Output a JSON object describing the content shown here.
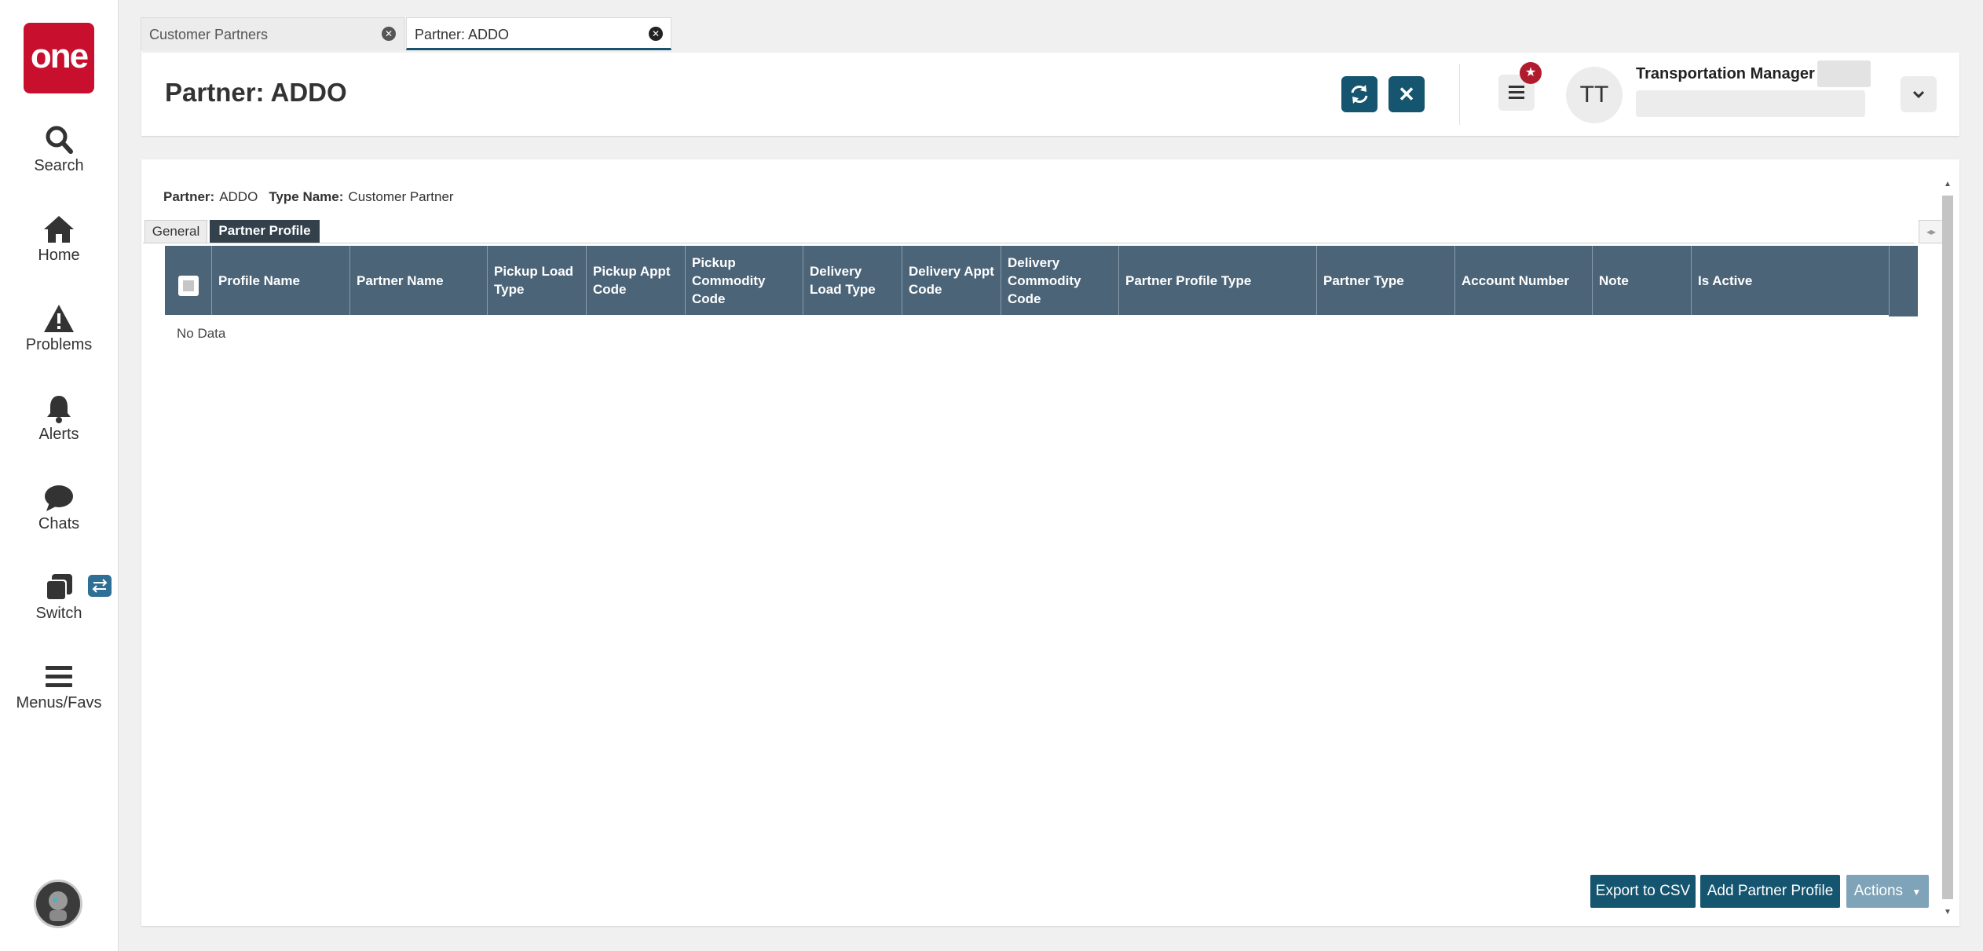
{
  "nav": {
    "logo_text": "one",
    "items": [
      {
        "label": "Search",
        "icon": "search-icon"
      },
      {
        "label": "Home",
        "icon": "home-icon"
      },
      {
        "label": "Problems",
        "icon": "warning-icon"
      },
      {
        "label": "Alerts",
        "icon": "bell-icon"
      },
      {
        "label": "Chats",
        "icon": "chat-bubble-icon"
      },
      {
        "label": "Switch",
        "icon": "switch-icon"
      },
      {
        "label": "Menus/Favs",
        "icon": "hamburger-menu-icon"
      }
    ]
  },
  "tabs": [
    {
      "label": "Customer Partners",
      "active": false
    },
    {
      "label": "Partner: ADDO",
      "active": true
    }
  ],
  "header": {
    "title": "Partner: ADDO",
    "user_initials": "TT",
    "user_role": "Transportation Manager"
  },
  "summary": {
    "partner_label": "Partner:",
    "partner_value": "ADDO",
    "type_label": "Type Name:",
    "type_value": "Customer Partner"
  },
  "subtabs": [
    {
      "label": "General",
      "active": false
    },
    {
      "label": "Partner Profile",
      "active": true
    }
  ],
  "grid": {
    "columns": [
      "Profile Name",
      "Partner Name",
      "Pickup Load Type",
      "Pickup Appt Code",
      "Pickup Commodity Code",
      "Delivery Load Type",
      "Delivery Appt Code",
      "Delivery Commodity Code",
      "Partner Profile Type",
      "Partner Type",
      "Account Number",
      "Note",
      "Is Active"
    ],
    "empty_text": "No Data"
  },
  "footer": {
    "export_label": "Export to CSV",
    "add_label": "Add Partner Profile",
    "actions_label": "Actions"
  },
  "colors": {
    "brand_red": "#c8102e",
    "primary_button": "#15556f",
    "grid_header": "#4b6478",
    "active_subtab": "#33414c",
    "actions_button": "#7fa3b8"
  }
}
